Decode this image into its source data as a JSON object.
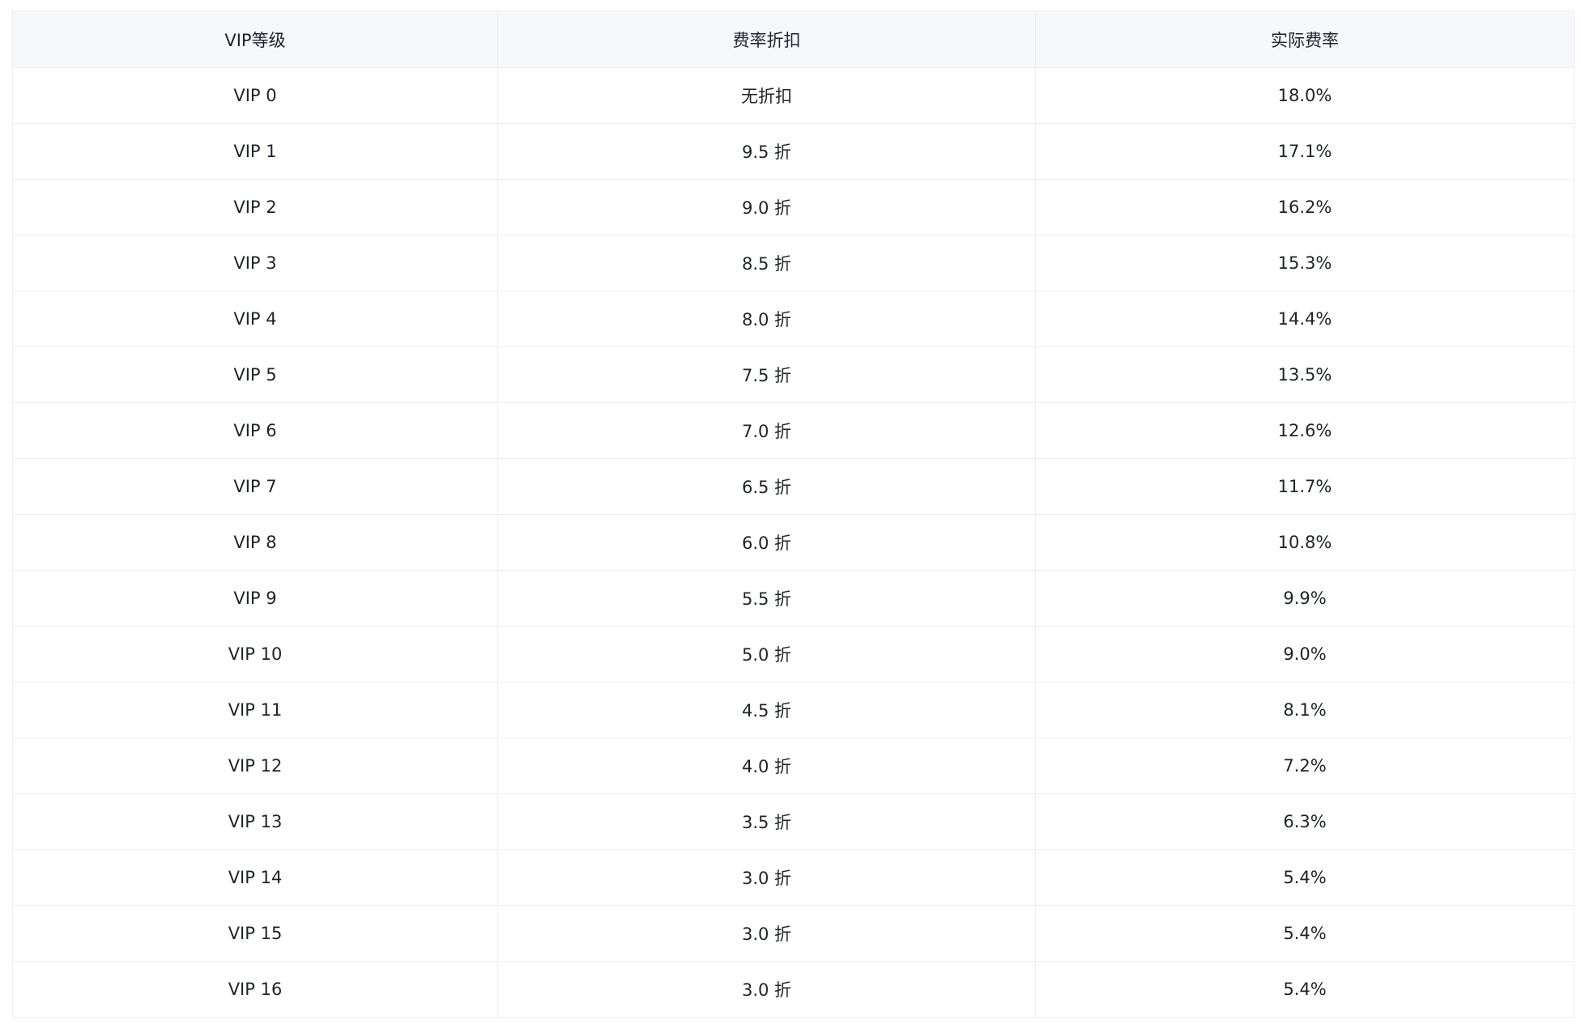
{
  "table": {
    "headers": [
      "VIP等级",
      "费率折扣",
      "实际费率"
    ],
    "rows": [
      [
        "VIP 0",
        "无折扣",
        "18.0%"
      ],
      [
        "VIP 1",
        "9.5 折",
        "17.1%"
      ],
      [
        "VIP 2",
        "9.0 折",
        "16.2%"
      ],
      [
        "VIP 3",
        "8.5 折",
        "15.3%"
      ],
      [
        "VIP 4",
        "8.0 折",
        "14.4%"
      ],
      [
        "VIP 5",
        "7.5 折",
        "13.5%"
      ],
      [
        "VIP 6",
        "7.0 折",
        "12.6%"
      ],
      [
        "VIP 7",
        "6.5 折",
        "11.7%"
      ],
      [
        "VIP 8",
        "6.0 折",
        "10.8%"
      ],
      [
        "VIP 9",
        "5.5 折",
        "9.9%"
      ],
      [
        "VIP 10",
        "5.0 折",
        "9.0%"
      ],
      [
        "VIP 11",
        "4.5 折",
        "8.1%"
      ],
      [
        "VIP 12",
        "4.0 折",
        "7.2%"
      ],
      [
        "VIP 13",
        "3.5 折",
        "6.3%"
      ],
      [
        "VIP 14",
        "3.0 折",
        "5.4%"
      ],
      [
        "VIP 15",
        "3.0 折",
        "5.4%"
      ],
      [
        "VIP 16",
        "3.0 折",
        "5.4%"
      ]
    ]
  },
  "colors": {
    "header_bg": "#f7f8fb",
    "border": "#eceef2",
    "text": "#1f2329"
  }
}
